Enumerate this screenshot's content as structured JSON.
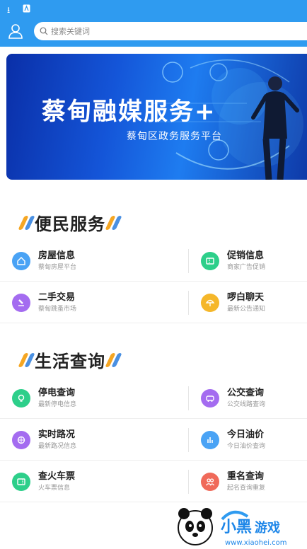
{
  "search": {
    "placeholder": "搜索关键词"
  },
  "banner": {
    "title": "蔡甸融媒服务+",
    "subtitle": "蔡甸区政务服务平台"
  },
  "sections": [
    {
      "title": "便民服务",
      "items": [
        {
          "title": "房屋信息",
          "subtitle": "蔡甸房屋平台",
          "icon": "house-icon",
          "color": "#4aa3f5"
        },
        {
          "title": "促销信息",
          "subtitle": "商家广告促销",
          "icon": "ticket-icon",
          "color": "#2dcf8a"
        },
        {
          "title": "二手交易",
          "subtitle": "蔡甸跳蚤市场",
          "icon": "gavel-icon",
          "color": "#a46cf0"
        },
        {
          "title": "啰白聊天",
          "subtitle": "最新公告通知",
          "icon": "umbrella-icon",
          "color": "#f5b72a"
        }
      ]
    },
    {
      "title": "生活查询",
      "items": [
        {
          "title": "停电查询",
          "subtitle": "最新停电信息",
          "icon": "bulb-icon",
          "color": "#2dcf8a"
        },
        {
          "title": "公交查询",
          "subtitle": "公交线路查询",
          "icon": "bus-icon",
          "color": "#a46cf0"
        },
        {
          "title": "实时路况",
          "subtitle": "最新路况信息",
          "icon": "road-icon",
          "color": "#a46cf0"
        },
        {
          "title": "今日油价",
          "subtitle": "今日油价查询",
          "icon": "chart-icon",
          "color": "#4aa3f5"
        },
        {
          "title": "查火车票",
          "subtitle": "火车票信息",
          "icon": "train-ticket-icon",
          "color": "#2dcf8a"
        },
        {
          "title": "重名查询",
          "subtitle": "起名查询重复",
          "icon": "people-icon",
          "color": "#f06a5a"
        }
      ]
    }
  ],
  "watermark": {
    "brand": "小黑游戏",
    "url": "www.xiaohei.com"
  }
}
